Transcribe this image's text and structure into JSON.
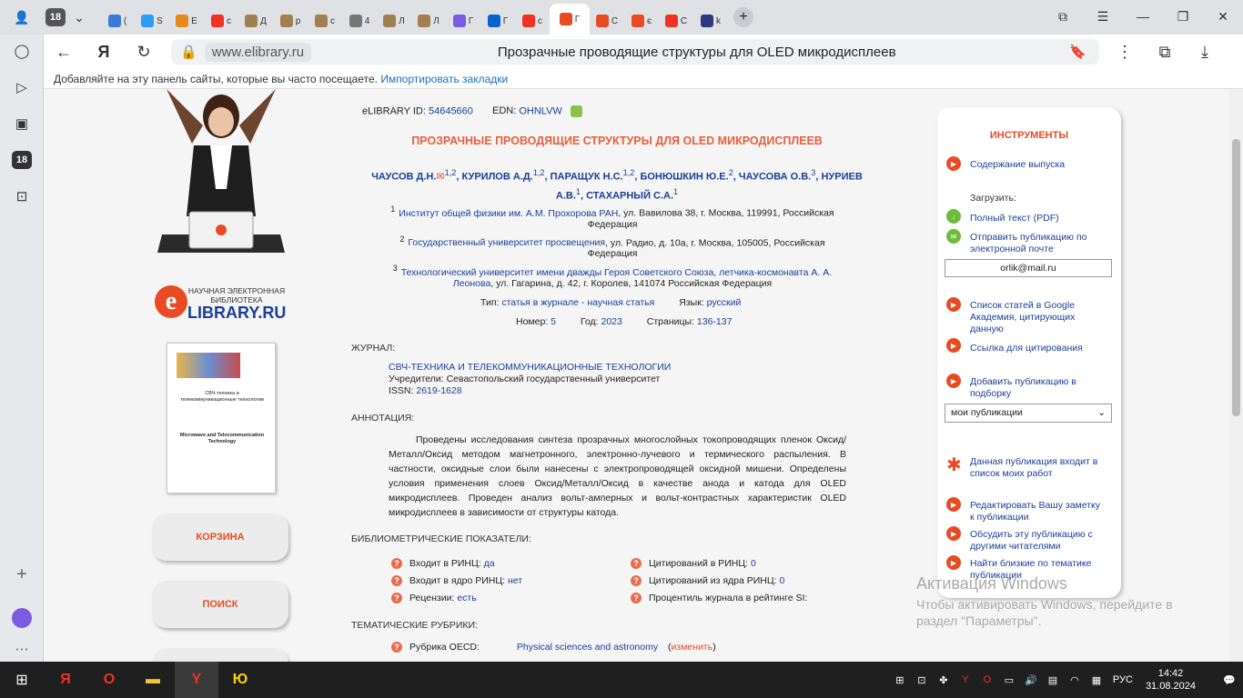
{
  "browser": {
    "tabs_count": "18",
    "tabs": [
      {
        "label": "(",
        "color": "#3a7bd5"
      },
      {
        "label": "S",
        "color": "#2a9df4"
      },
      {
        "label": "E",
        "color": "#e38b1c"
      },
      {
        "label": "с",
        "color": "#e32"
      },
      {
        "label": "Д",
        "color": "#a08050"
      },
      {
        "label": "р",
        "color": "#a08050"
      },
      {
        "label": "с",
        "color": "#a08050"
      },
      {
        "label": "4",
        "color": "#777"
      },
      {
        "label": "Л",
        "color": "#a08050"
      },
      {
        "label": "Л",
        "color": "#a08050"
      },
      {
        "label": "Г",
        "color": "#7b5be0"
      },
      {
        "label": "Г",
        "color": "#0a63c9"
      },
      {
        "label": "с",
        "color": "#e32"
      },
      {
        "label": "Г",
        "color": "#e84b23",
        "active": true
      },
      {
        "label": "С",
        "color": "#e84b23"
      },
      {
        "label": "є",
        "color": "#e84b23"
      },
      {
        "label": "С",
        "color": "#e32"
      },
      {
        "label": "k",
        "color": "#2a3a7a"
      }
    ],
    "domain": "www.elibrary.ru",
    "page_title": "Прозрачные проводящие структуры для OLED микродисплеев",
    "bookmarks_prompt": "Добавляйте на эту панель сайты, которые вы часто посещаете.",
    "bookmarks_import": "Импортировать закладки",
    "side_badge": "18"
  },
  "left": {
    "logo_line1": "НАУЧНАЯ ЭЛЕКТРОННАЯ",
    "logo_line2": "БИБЛИОТЕКА",
    "logo_main": "LIBRARY.RU",
    "cover_title": "СВЧ-техника и телекоммуникационные технологии",
    "cover_subtitle": "Microwave and Telecommunication Technology",
    "cart_btn": "КОРЗИНА",
    "search_btn": "ПОИСК"
  },
  "article": {
    "elibrary_id_label": "eLIBRARY ID:",
    "elibrary_id": "54645660",
    "edn_label": "EDN:",
    "edn": "OHNLVW",
    "title": "ПРОЗРАЧНЫЕ ПРОВОДЯЩИЕ СТРУКТУРЫ ДЛЯ OLED МИКРОДИСПЛЕЕВ",
    "authors": [
      {
        "name": "ЧАУСОВ Д.Н.",
        "sup": "1,2"
      },
      {
        "name": "КУРИЛОВ А.Д.",
        "sup": "1,2"
      },
      {
        "name": "ПАРАЩУК Н.С.",
        "sup": "1,2"
      },
      {
        "name": "БОНЮШКИН Ю.Е.",
        "sup": "2"
      },
      {
        "name": "ЧАУСОВА О.В.",
        "sup": "3"
      },
      {
        "name": "НУРИЕВ А.В.",
        "sup": "1"
      },
      {
        "name": "СТАХАРНЫЙ С.А.",
        "sup": "1"
      }
    ],
    "affiliations": [
      {
        "num": "1",
        "link": "Институт общей физики им. А.М. Прохорова РАН",
        "rest": ", ул. Вавилова 38, г. Москва, 119991, Российская Федерация"
      },
      {
        "num": "2",
        "link": "Государственный университет просвещения",
        "rest": ", ул. Радио, д. 10а, г. Москва, 105005, Российская Федерация"
      },
      {
        "num": "3",
        "link": "Технологический университет имени дважды Героя Советского Союза, летчика-космонавта А. А. Леонова",
        "rest": ", ул. Гагарина, д. 42, г. Королев, 141074 Российская Федерация"
      }
    ],
    "type_label": "Тип:",
    "type": "статья в журнале - научная статья",
    "lang_label": "Язык:",
    "lang": "русский",
    "issue_label": "Номер:",
    "issue": "5",
    "year_label": "Год:",
    "year": "2023",
    "pages_label": "Страницы:",
    "pages": "136-137",
    "journal_section": "ЖУРНАЛ:",
    "journal_name": "СВЧ-ТЕХНИКА И ТЕЛЕКОММУНИКАЦИОННЫЕ ТЕХНОЛОГИИ",
    "founders": "Учредители: Севастопольский государственный университет",
    "issn_label": "ISSN:",
    "issn": "2619-1628",
    "abstract_section": "АННОТАЦИЯ:",
    "abstract": "Проведены исследования синтеза прозрачных многослойных токопроводящих пленок Оксид/Металл/Оксид методом магнетронного, электронно-лучевого и термического распыления. В частности, оксидные слои были нанесены с электропроводящей оксидной мишени. Определены условия применения слоев Оксид/Металл/Оксид в качестве анода и катода для OLED микродисплеев. Проведен анализ вольт-амперных и вольт-контрастных характеристик OLED микродисплеев в зависимости от структуры катода.",
    "biblio_section": "БИБЛИОМЕТРИЧЕСКИЕ ПОКАЗАТЕЛИ:",
    "metrics": {
      "rinc_label": "Входит в РИНЦ:",
      "rinc": "да",
      "core_label": "Входит в ядро РИНЦ:",
      "core": "нет",
      "reviews_label": "Рецензии:",
      "reviews": "есть",
      "cit_label": "Цитирований в РИНЦ:",
      "cit": "0",
      "citcore_label": "Цитирований из ядра РИНЦ:",
      "citcore": "0",
      "pct_label": "Процентиль журнала в рейтинге SI:"
    },
    "rubric_section": "ТЕМАТИЧЕСКИЕ РУБРИКИ:",
    "rubric_label": "Рубрика OECD:",
    "rubric_value": "Physical sciences and astronomy",
    "rubric_change": "изменить"
  },
  "tools": {
    "title": "ИНСТРУМЕНТЫ",
    "contents": "Содержание выпуска",
    "download_label": "Загрузить:",
    "fulltext": "Полный текст (PDF)",
    "send_email": "Отправить публикацию по электронной почте",
    "email_value": "orlik@mail.ru",
    "google": "Список статей в Google Академия, цитирующих данную",
    "cite": "Ссылка для цитирования",
    "add_collection": "Добавить публикацию в подборку",
    "collection_select": "мои публикации",
    "in_my_list": "Данная публикация входит в список моих работ",
    "edit_note": "Редактировать Вашу заметку к публикации",
    "discuss": "Обсудить эту публикацию с другими читателями",
    "similar": "Найти близкие по тематике публикации"
  },
  "watermark": {
    "line1": "Активация Windows",
    "line2": "Чтобы активировать Windows, перейдите в",
    "line3": "раздел \"Параметры\"."
  },
  "taskbar": {
    "lang": "РУС",
    "time": "14:42",
    "date": "31.08.2024"
  }
}
